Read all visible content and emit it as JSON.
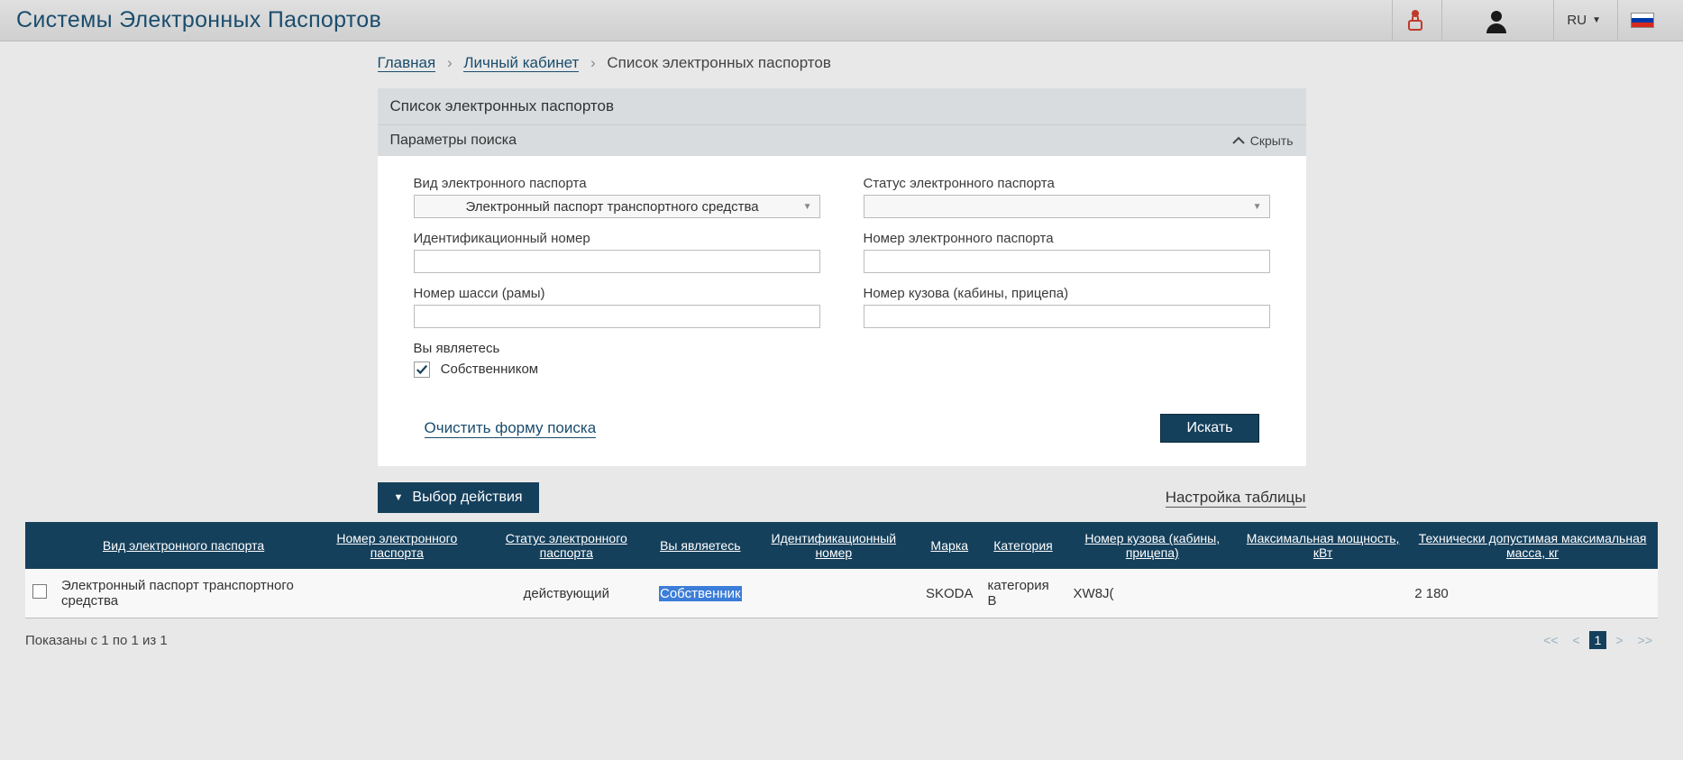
{
  "header": {
    "title": "Системы Электронных Паспортов",
    "language": "RU"
  },
  "breadcrumb": {
    "home": "Главная",
    "account": "Личный кабинет",
    "current": "Список электронных паспортов"
  },
  "panel": {
    "title": "Список электронных паспортов",
    "search_title": "Параметры поиска",
    "collapse": "Скрыть"
  },
  "fields": {
    "type_label": "Вид электронного паспорта",
    "type_value": "Электронный паспорт транспортного средства",
    "status_label": "Статус электронного паспорта",
    "id_label": "Идентификационный номер",
    "num_label": "Номер электронного паспорта",
    "chassis_label": "Номер шасси (рамы)",
    "body_label": "Номер кузова (кабины, прицепа)",
    "you_are_label": "Вы являетесь",
    "you_are_value": "Собственником"
  },
  "actions": {
    "clear": "Очистить форму поиска",
    "search": "Искать",
    "choose_action": "Выбор действия",
    "table_settings": "Настройка таблицы"
  },
  "table": {
    "headers": [
      "Вид электронного паспорта",
      "Номер электронного паспорта",
      "Статус электронного паспорта",
      "Вы являетесь",
      "Идентификационный номер",
      "Марка",
      "Категория",
      "Номер кузова (кабины, прицепа)",
      "Максимальная мощность, кВт",
      "Технически допустимая максимальная масса, кг"
    ],
    "row": {
      "type": "Электронный паспорт транспортного средства",
      "number": "",
      "status": "действующий",
      "you_are": "Собственник",
      "ident": "",
      "brand": "SKODA",
      "category": "категория B",
      "body": "XW8J(",
      "power": "",
      "mass": "2 180"
    }
  },
  "footer": {
    "shown": "Показаны с 1 по 1 из 1",
    "page": "1"
  }
}
